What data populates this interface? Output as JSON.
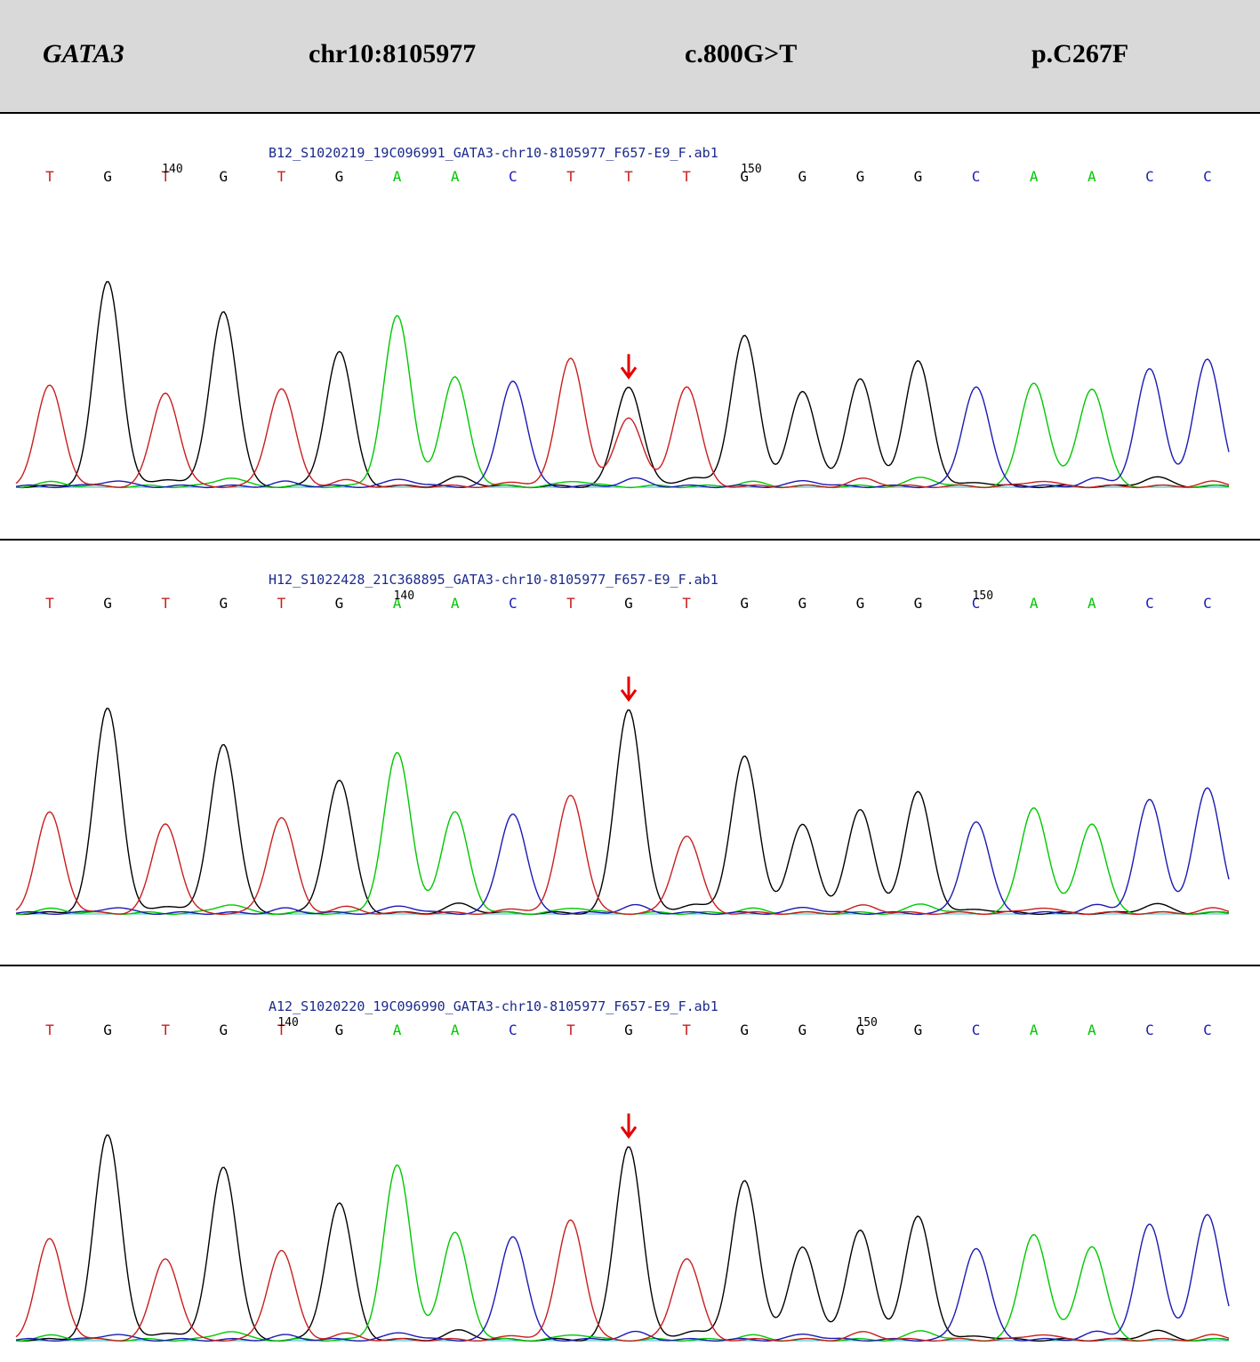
{
  "header": {
    "gene": "GATA3",
    "locus": "chr10:8105977",
    "cdna": "c.800G>T",
    "protein": "p.C267F"
  },
  "colors": {
    "A": "#00c800",
    "C": "#1a1ab4",
    "G": "#000000",
    "T": "#c81e1e",
    "arrow": "#e60000",
    "header_bg": "#d9d9d9",
    "filename": "#1b2a8c"
  },
  "chart_data": [
    {
      "type": "line",
      "chart": "Sanger sequencing chromatogram",
      "filename": "B12_S1020219_19C096991_GATA3-chr10-8105977_F657-E9_F.ab1",
      "bases": [
        "T",
        "G",
        "T",
        "G",
        "T",
        "G",
        "A",
        "A",
        "C",
        "T",
        "T",
        "T",
        "G",
        "G",
        "G",
        "G",
        "C",
        "A",
        "A",
        "C",
        "C"
      ],
      "position_labels": [
        {
          "label": "140",
          "base_index": 2
        },
        {
          "label": "150",
          "base_index": 12
        }
      ],
      "peak_heights": [
        0.49,
        1.0,
        0.46,
        0.86,
        0.48,
        0.66,
        0.83,
        0.53,
        0.52,
        0.63,
        0.48,
        0.49,
        0.74,
        0.46,
        0.52,
        0.61,
        0.49,
        0.51,
        0.48,
        0.57,
        0.62
      ],
      "secondary_peaks": [
        {
          "base_index": 10,
          "base": "G",
          "height": 0.49
        },
        {
          "base_index": 10,
          "base": "T",
          "height": 0.34
        }
      ],
      "arrow_base_index": 10
    },
    {
      "type": "line",
      "chart": "Sanger sequencing chromatogram",
      "filename": "H12_S1022428_21C368895_GATA3-chr10-8105977_F657-E9_F.ab1",
      "bases": [
        "T",
        "G",
        "T",
        "G",
        "T",
        "G",
        "A",
        "A",
        "C",
        "T",
        "G",
        "T",
        "G",
        "G",
        "G",
        "G",
        "C",
        "A",
        "A",
        "C",
        "C"
      ],
      "position_labels": [
        {
          "label": "140",
          "base_index": 6
        },
        {
          "label": "150",
          "base_index": 16
        }
      ],
      "peak_heights": [
        0.49,
        1.0,
        0.44,
        0.83,
        0.47,
        0.65,
        0.78,
        0.49,
        0.49,
        0.58,
        1.0,
        0.38,
        0.77,
        0.43,
        0.5,
        0.59,
        0.45,
        0.52,
        0.44,
        0.55,
        0.61
      ],
      "secondary_peaks": [],
      "arrow_base_index": 10
    },
    {
      "type": "line",
      "chart": "Sanger sequencing chromatogram",
      "filename": "A12_S1020220_19C096990_GATA3-chr10-8105977_F657-E9_F.ab1",
      "bases": [
        "T",
        "G",
        "T",
        "G",
        "T",
        "G",
        "A",
        "A",
        "C",
        "T",
        "G",
        "T",
        "G",
        "G",
        "G",
        "G",
        "C",
        "A",
        "A",
        "C",
        "C"
      ],
      "position_labels": [
        {
          "label": "140",
          "base_index": 4
        },
        {
          "label": "150",
          "base_index": 14
        }
      ],
      "peak_heights": [
        0.49,
        1.0,
        0.4,
        0.85,
        0.44,
        0.67,
        0.85,
        0.52,
        0.51,
        0.59,
        0.95,
        0.4,
        0.78,
        0.45,
        0.53,
        0.6,
        0.45,
        0.52,
        0.46,
        0.56,
        0.61
      ],
      "secondary_peaks": [],
      "arrow_base_index": 10
    }
  ]
}
